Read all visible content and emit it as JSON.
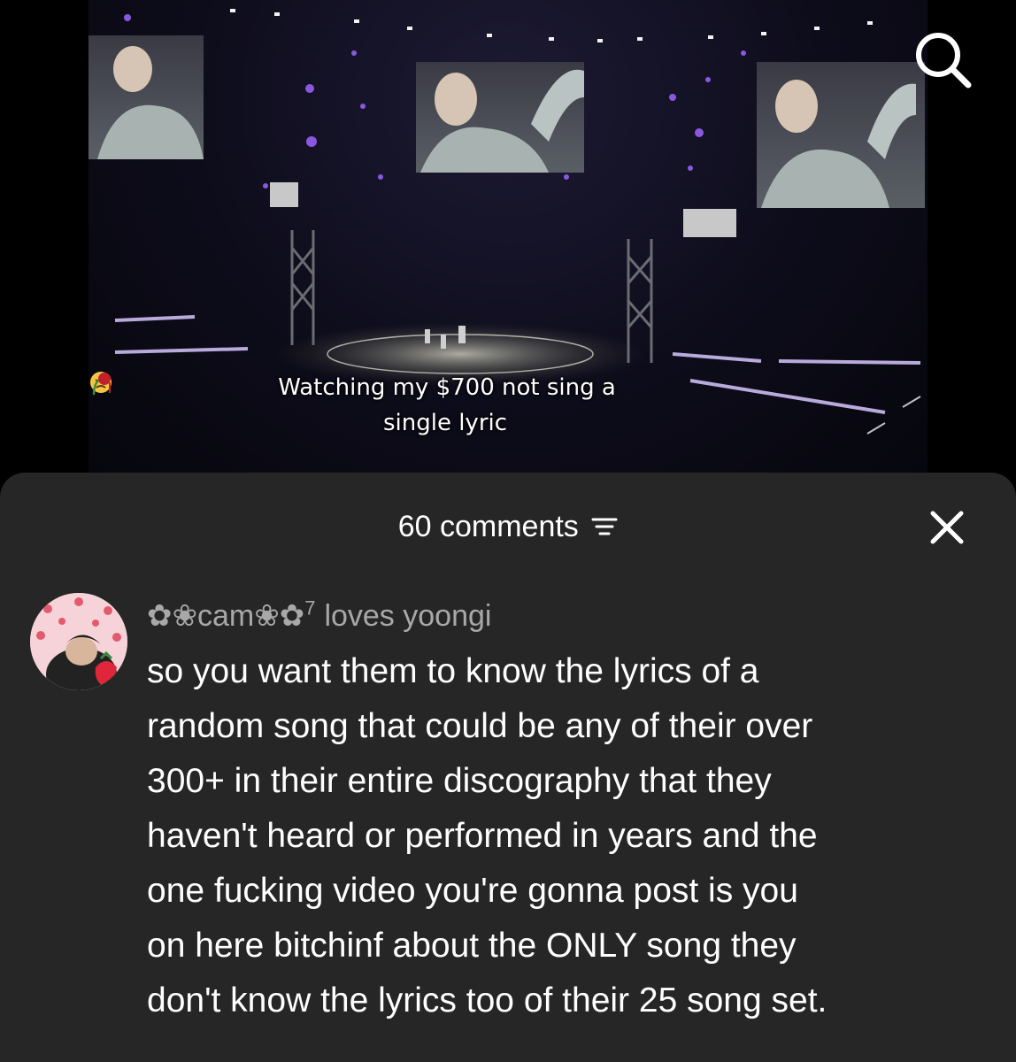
{
  "video": {
    "caption_line1": "Watching my $700 not sing a",
    "caption_line2": "single lyric",
    "caption_emojis": [
      "disappointed-face-emoji",
      "wilted-flower-emoji"
    ],
    "search_icon": "search-icon"
  },
  "comments_sheet": {
    "count_label": "60 comments",
    "sort_icon": "sort-icon",
    "close_icon": "close-icon",
    "comment": {
      "author_name": "✿❀cam❀✿",
      "author_superscript": "7",
      "author_tag": "loves yoongi",
      "text_lines": [
        "so you want them to know the lyrics of a",
        "random song that could be any of their over",
        "300+ in their entire discography that they",
        "haven't heard or performed in years and the",
        "one fucking video you're gonna post is you",
        "on here bitchinf about the ONLY song they",
        "don't know the lyrics too of their 25 song set."
      ],
      "avatar_icon": "avatar"
    }
  },
  "colors": {
    "sheet_bg": "#262626",
    "muted_text": "#a8a8a8",
    "text": "#ffffff",
    "background": "#000000"
  }
}
